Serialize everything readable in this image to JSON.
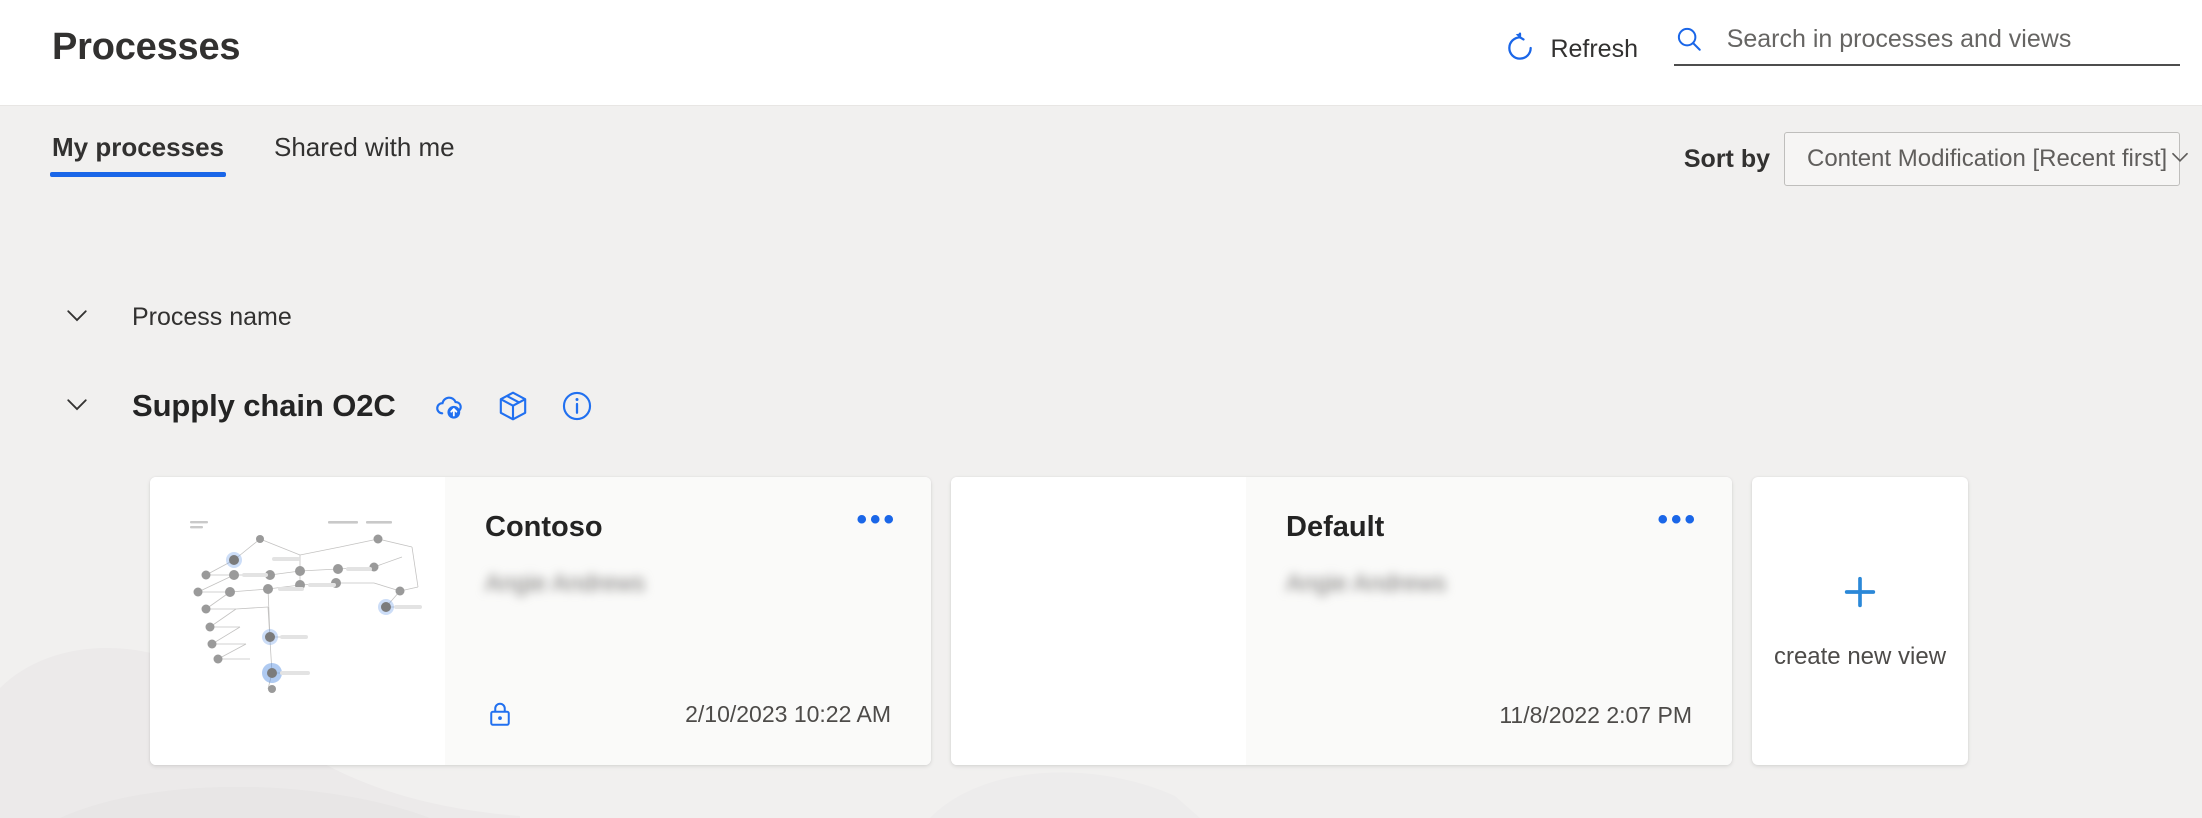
{
  "header": {
    "title": "Processes",
    "refresh_label": "Refresh",
    "refresh_icon": "refresh-circular-arrow-icon",
    "search_icon": "search-magnifier-icon",
    "search_placeholder": "Search in processes and views",
    "search_value": ""
  },
  "tabs": [
    {
      "label": "My processes",
      "active": true
    },
    {
      "label": "Shared with me",
      "active": false
    }
  ],
  "sort": {
    "label": "Sort by",
    "selected": "Content Modification [Recent first]",
    "chevron_icon": "chevron-down-icon"
  },
  "list": {
    "column_header": "Process name",
    "collapse_icon": "chevron-down-icon"
  },
  "process": {
    "name": "Supply chain O2C",
    "icons": [
      {
        "name": "cloud-upload-icon"
      },
      {
        "name": "package-box-icon"
      },
      {
        "name": "info-circle-icon"
      }
    ]
  },
  "views": [
    {
      "title": "Contoso",
      "author": "Angie Andrews",
      "date": "2/10/2023 10:22 AM",
      "menu_label": "•••",
      "has_lock": true,
      "lock_icon": "lock-icon",
      "has_thumbnail": true
    },
    {
      "title": "Default",
      "author": "Angie Andrews",
      "date": "11/8/2022 2:07 PM",
      "menu_label": "•••",
      "has_lock": false,
      "lock_icon": "",
      "has_thumbnail": false
    }
  ],
  "create_card": {
    "label": "create new view",
    "plus_icon": "plus-icon"
  },
  "colors": {
    "accent_blue": "#1a66e8",
    "icon_blue": "#2170f0",
    "plus_blue": "#2b88d8",
    "page_bg": "#f1f0ef",
    "card_bg": "#ffffff",
    "card_body_bg": "#fafaf9",
    "text_primary": "#323130",
    "text_secondary": "#605e5c"
  }
}
